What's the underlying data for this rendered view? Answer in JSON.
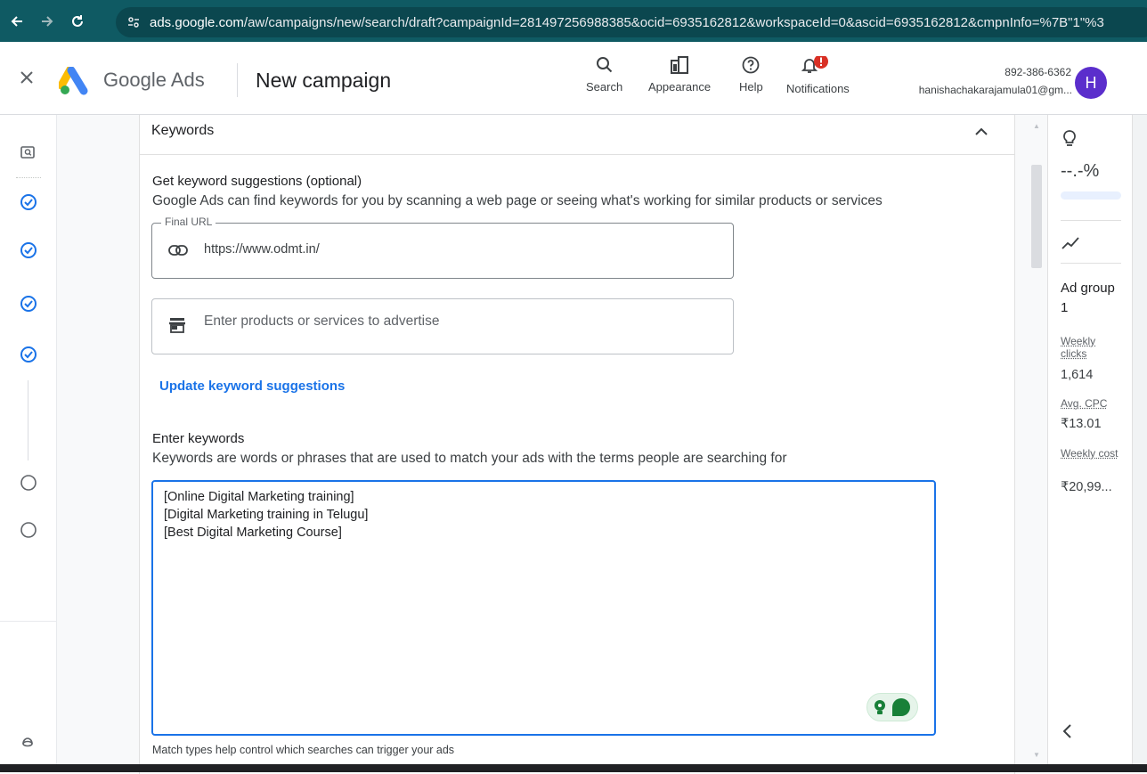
{
  "browser": {
    "url_domain": "ads.google.com",
    "url_path": "/aw/campaigns/new/search/draft?campaignId=281497256988385&ocid=6935162812&workspaceId=0&ascid=6935162812&cmpnInfo=%7B\"1\"%3"
  },
  "header": {
    "brand": "Google Ads",
    "title": "New campaign",
    "tools": [
      {
        "label": "Search",
        "icon": "search-icon"
      },
      {
        "label": "Appearance",
        "icon": "appearance-icon"
      },
      {
        "label": "Help",
        "icon": "help-icon"
      },
      {
        "label": "Notifications",
        "icon": "bell-icon",
        "badge": "!"
      }
    ],
    "account_id": "892-386-6362",
    "account_email": "hanishachakarajamula01@gm...",
    "avatar_letter": "H"
  },
  "keywords_card": {
    "title": "Keywords",
    "suggestions_title": "Get keyword suggestions (optional)",
    "suggestions_desc": "Google Ads can find keywords for you by scanning a web page or seeing what's working for similar products or services",
    "final_url_label": "Final URL",
    "final_url_value": "https://www.odmt.in/",
    "products_placeholder": "Enter products or services to advertise",
    "update_link": "Update keyword suggestions",
    "enter_title": "Enter keywords",
    "enter_desc": "Keywords are words or phrases that are used to match your ads with the terms people are searching for",
    "keywords": [
      "[Online Digital Marketing training]",
      "[Digital Marketing training in Telugu]",
      "[Best Digital Marketing Course]"
    ],
    "footnote": "Match types help control which searches can trigger your ads"
  },
  "side_panel": {
    "score": "--.-%",
    "ad_group": "Ad group 1",
    "metrics": [
      {
        "label": "Weekly clicks",
        "value": "1,614"
      },
      {
        "label": "Avg. CPC",
        "value": "₹13.01"
      },
      {
        "label": "Weekly cost",
        "value": "₹20,99..."
      }
    ]
  },
  "colors": {
    "browser_bar": "#0f5a63",
    "accent_blue": "#1a73e8",
    "avatar": "#5b2ecc",
    "badge_red": "#d93025"
  }
}
